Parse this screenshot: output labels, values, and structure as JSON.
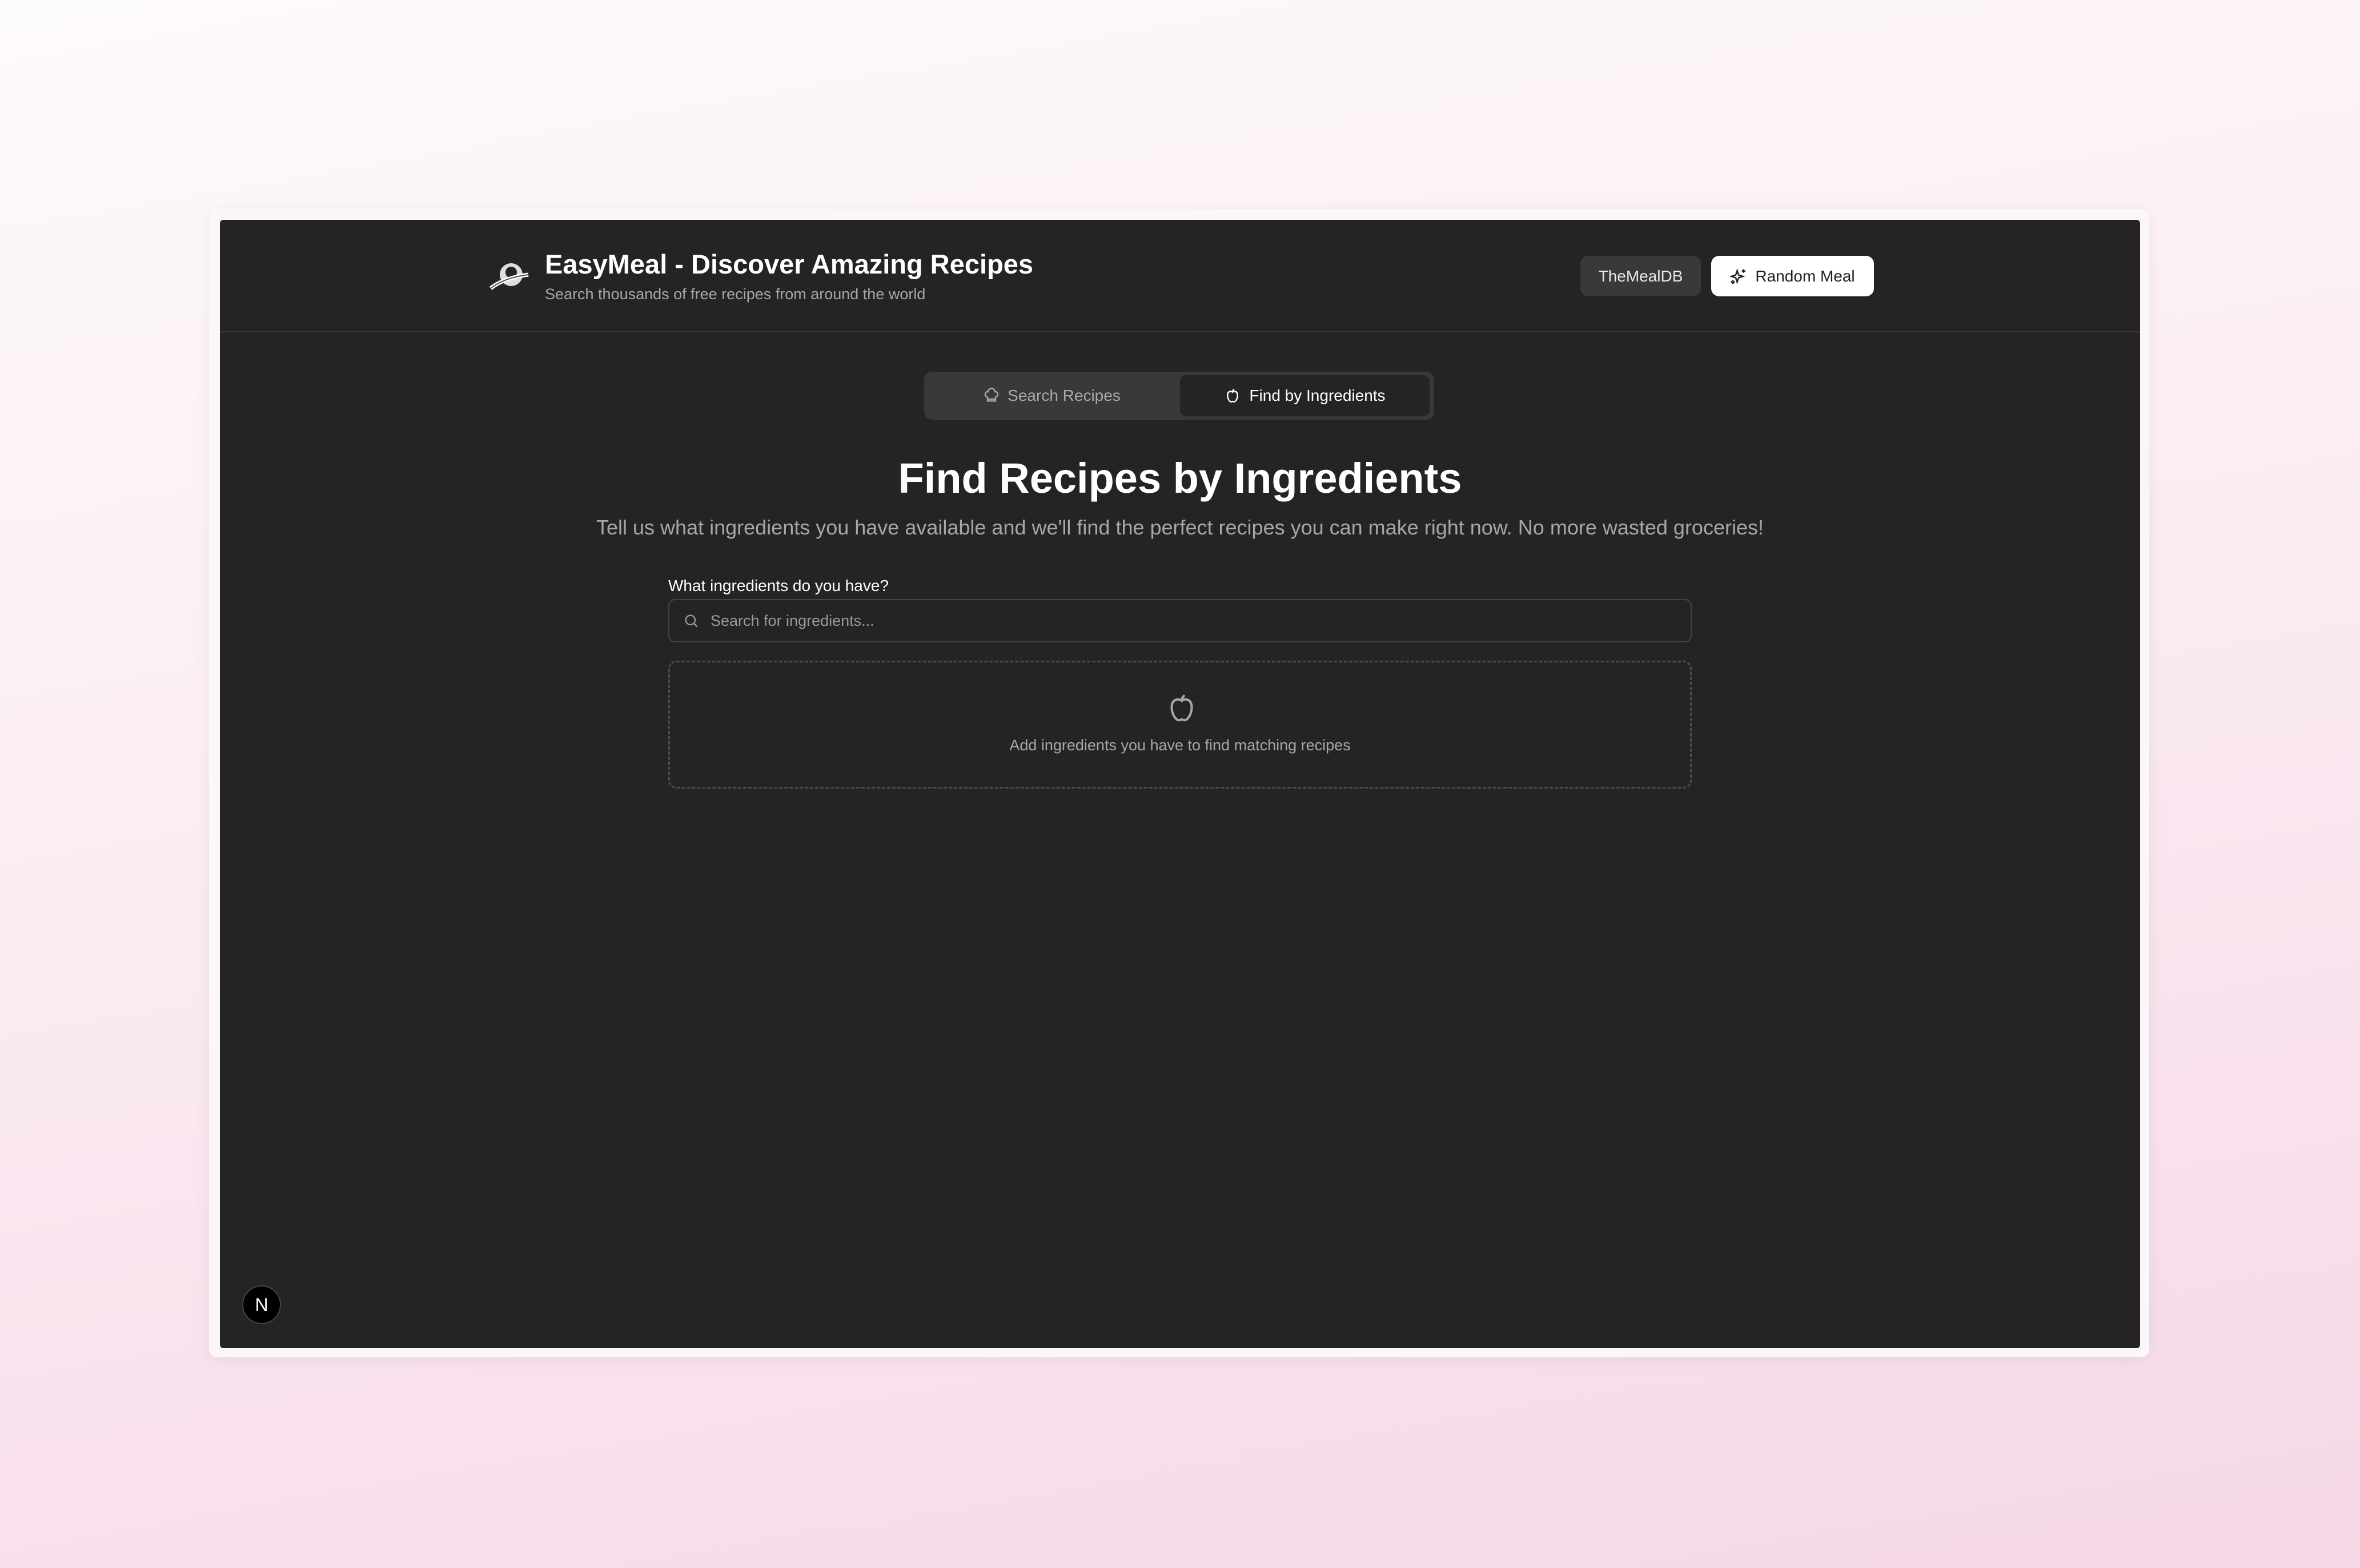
{
  "header": {
    "logo_text": "EasyMeal",
    "title": "EasyMeal - Discover Amazing Recipes",
    "subtitle": "Search thousands of free recipes from around the world",
    "themealdb_label": "TheMealDB",
    "random_meal_label": "Random Meal"
  },
  "tabs": [
    {
      "label": "Search Recipes",
      "icon": "chef-hat-icon",
      "active": false
    },
    {
      "label": "Find by Ingredients",
      "icon": "apple-icon",
      "active": true
    }
  ],
  "main": {
    "heading": "Find Recipes by Ingredients",
    "description": "Tell us what ingredients you have available and we'll find the perfect recipes you can make right now. No more wasted groceries!",
    "input_label": "What ingredients do you have?",
    "input_placeholder": "Search for ingredients...",
    "input_value": "",
    "empty_state_text": "Add ingredients you have to find matching recipes"
  },
  "dev_badge": "N"
}
